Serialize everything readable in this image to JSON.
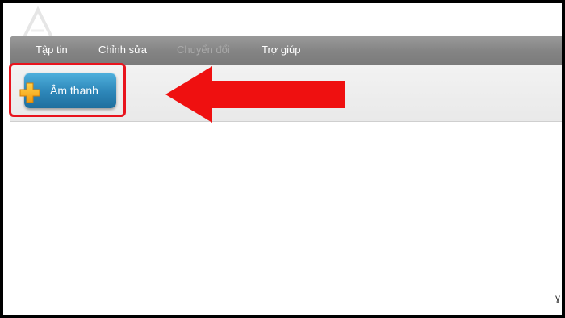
{
  "menu": {
    "items": [
      {
        "label": "Tập tin",
        "enabled": true
      },
      {
        "label": "Chỉnh sửa",
        "enabled": true
      },
      {
        "label": "Chuyển đổi",
        "enabled": false
      },
      {
        "label": "Trợ giúp",
        "enabled": true
      }
    ]
  },
  "toolbar": {
    "add_audio_label": "Âm thanh",
    "add_icon": "plus-icon"
  },
  "annotation": {
    "highlight_color": "#e8131d",
    "arrow_color": "#ef1010",
    "arrow_direction": "left"
  },
  "colors": {
    "menubar": "#848484",
    "button": "#2d86b8"
  }
}
